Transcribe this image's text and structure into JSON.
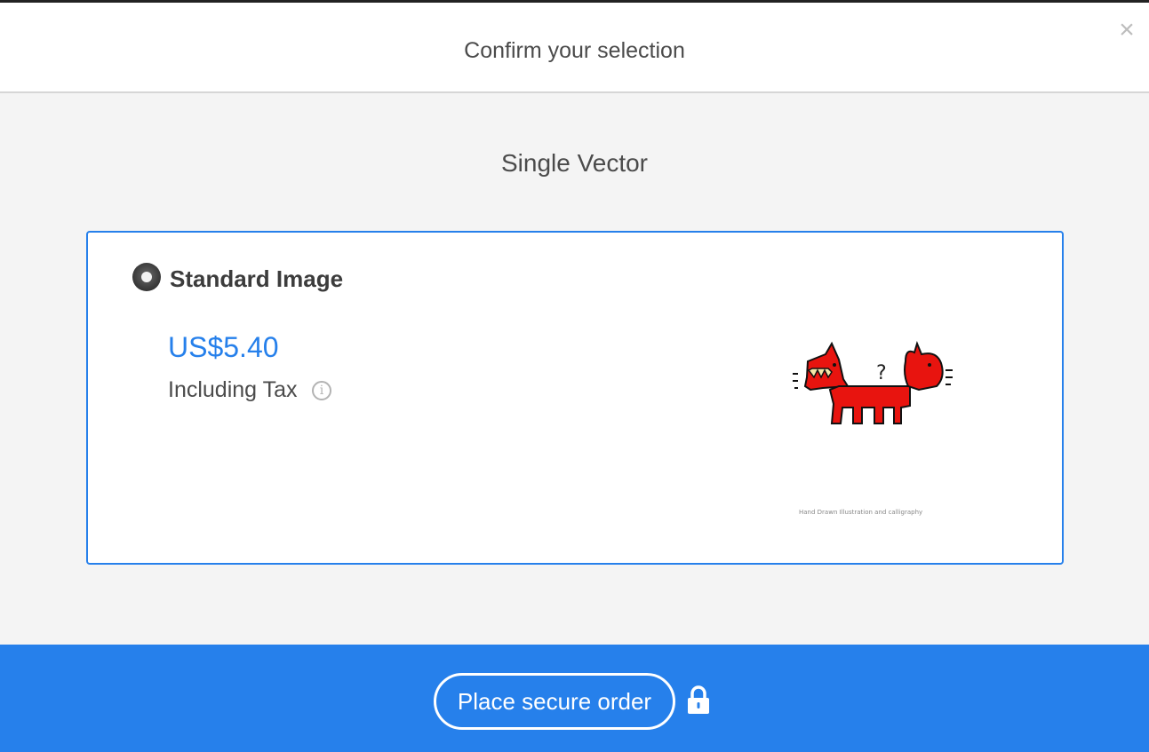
{
  "header": {
    "title": "Confirm your selection",
    "close_symbol": "×"
  },
  "section": {
    "title": "Single Vector"
  },
  "option": {
    "label": "Standard Image",
    "price": "US$5.40",
    "tax_label": "Including Tax",
    "info_symbol": "i",
    "selected": true,
    "thumbnail_caption": "Hand Drawn Illustration and calligraphy"
  },
  "footer": {
    "order_label": "Place secure order",
    "lock_icon": "lock-icon"
  },
  "colors": {
    "accent": "#2680eb",
    "footer_bg": "#2680eb",
    "thumbnail_dog": "#e8140f"
  }
}
